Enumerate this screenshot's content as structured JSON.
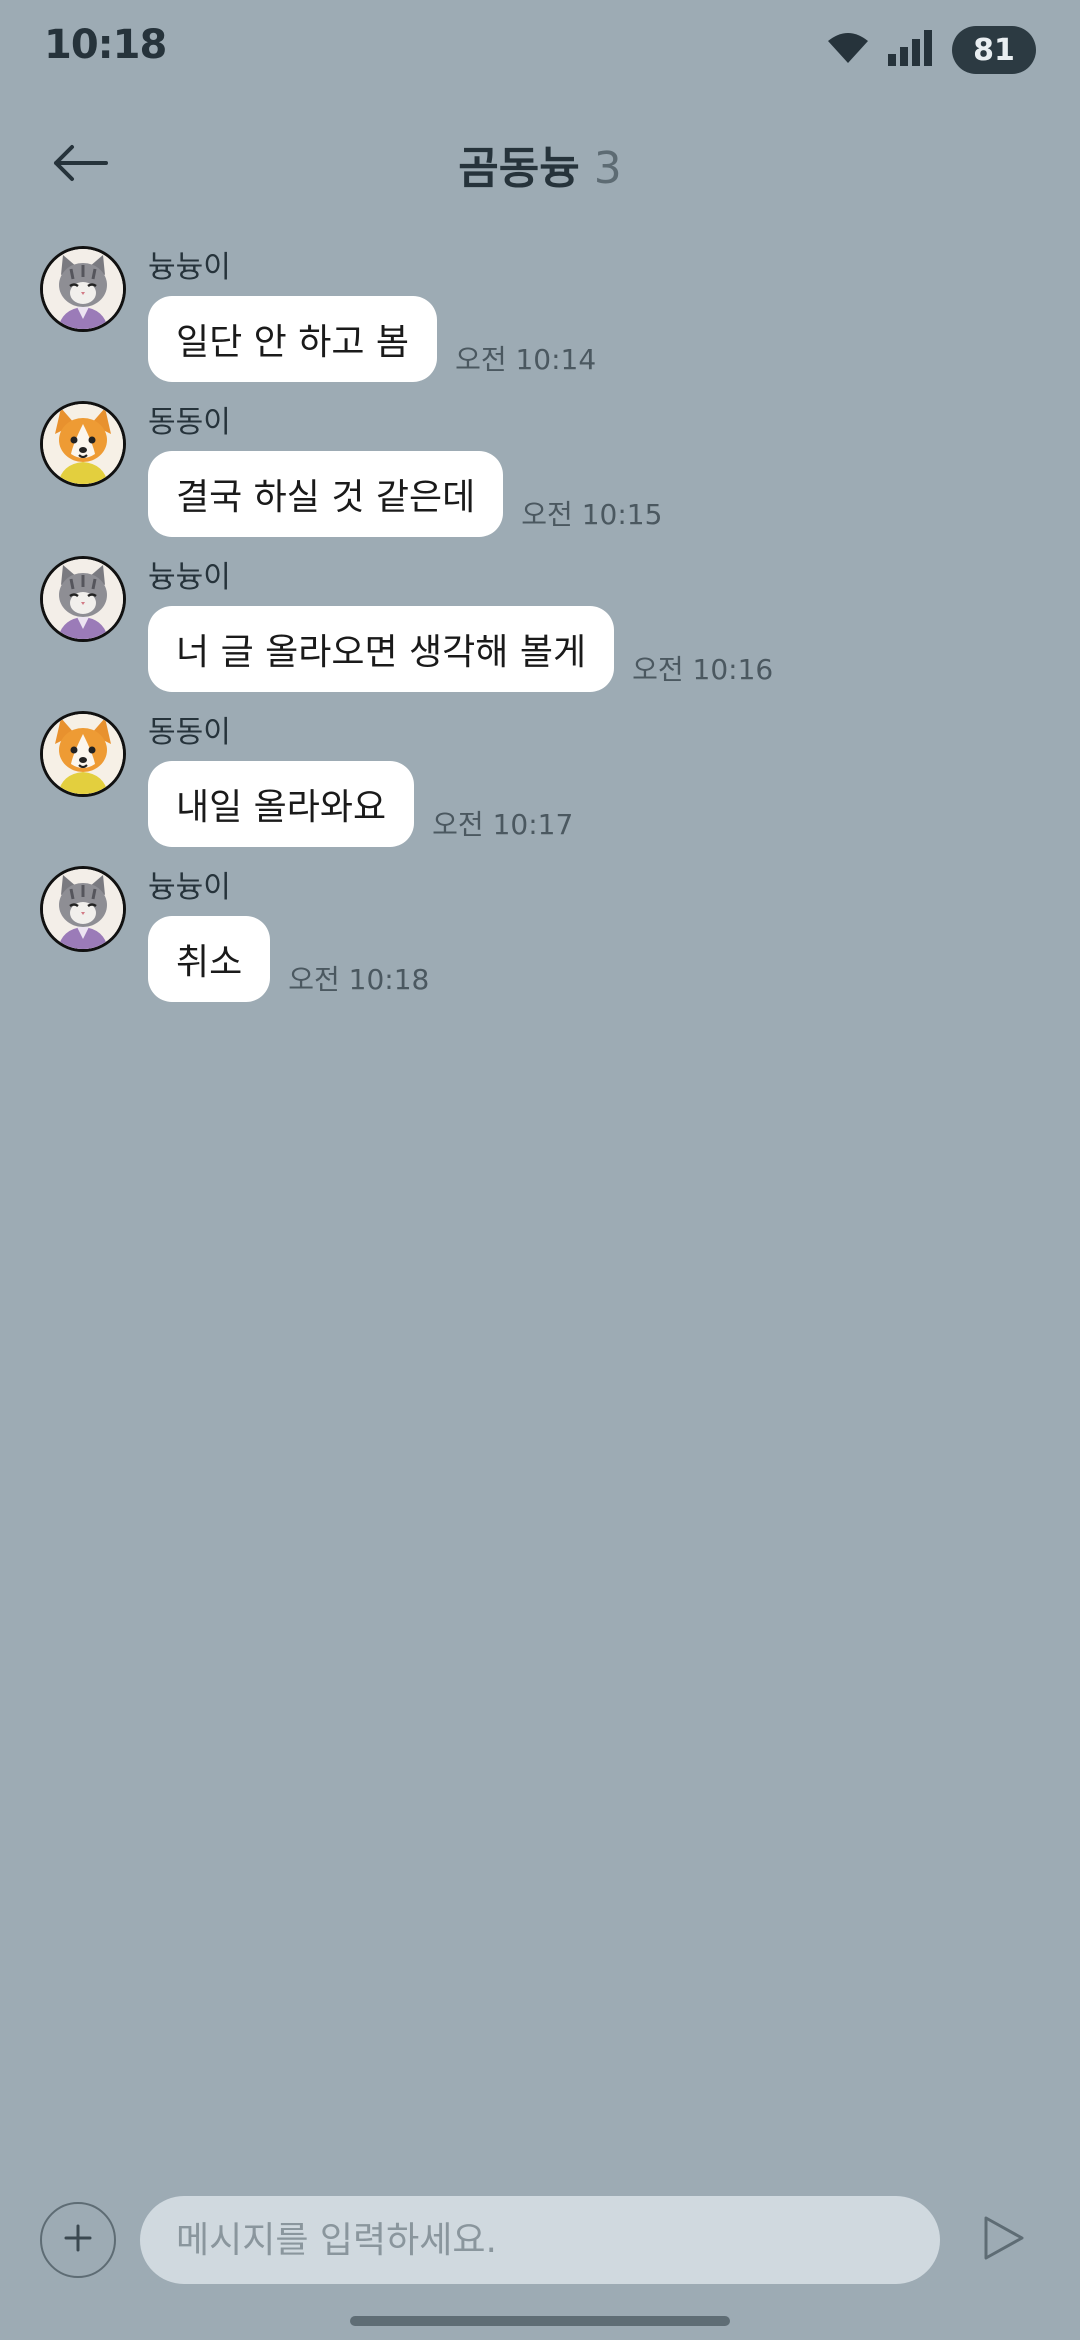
{
  "status_bar": {
    "time": "10:18",
    "battery": "81",
    "icons": [
      "wifi-icon",
      "signal-icon",
      "battery-icon"
    ]
  },
  "header": {
    "title": "곰동늉",
    "member_count": "3",
    "back_icon": "back-arrow-icon"
  },
  "messages": [
    {
      "sender": "늉늉이",
      "avatar": "cat-avatar",
      "text": "일단 안 하고 봄",
      "time": "오전 10:14"
    },
    {
      "sender": "동동이",
      "avatar": "dog-avatar",
      "text": "결국 하실 것 같은데",
      "time": "오전 10:15"
    },
    {
      "sender": "늉늉이",
      "avatar": "cat-avatar",
      "text": "너 글 올라오면 생각해 볼게",
      "time": "오전 10:16"
    },
    {
      "sender": "동동이",
      "avatar": "dog-avatar",
      "text": "내일 올라와요",
      "time": "오전 10:17"
    },
    {
      "sender": "늉늉이",
      "avatar": "cat-avatar",
      "text": "취소",
      "time": "오전 10:18"
    }
  ],
  "input_bar": {
    "placeholder": "메시지를 입력하세요.",
    "value": "",
    "add_icon": "plus-icon",
    "send_icon": "send-icon"
  },
  "colors": {
    "background": "#9dabb4",
    "bubble": "#ffffff",
    "input_background": "#d0d9df",
    "battery_pill": "#2c3a42"
  }
}
